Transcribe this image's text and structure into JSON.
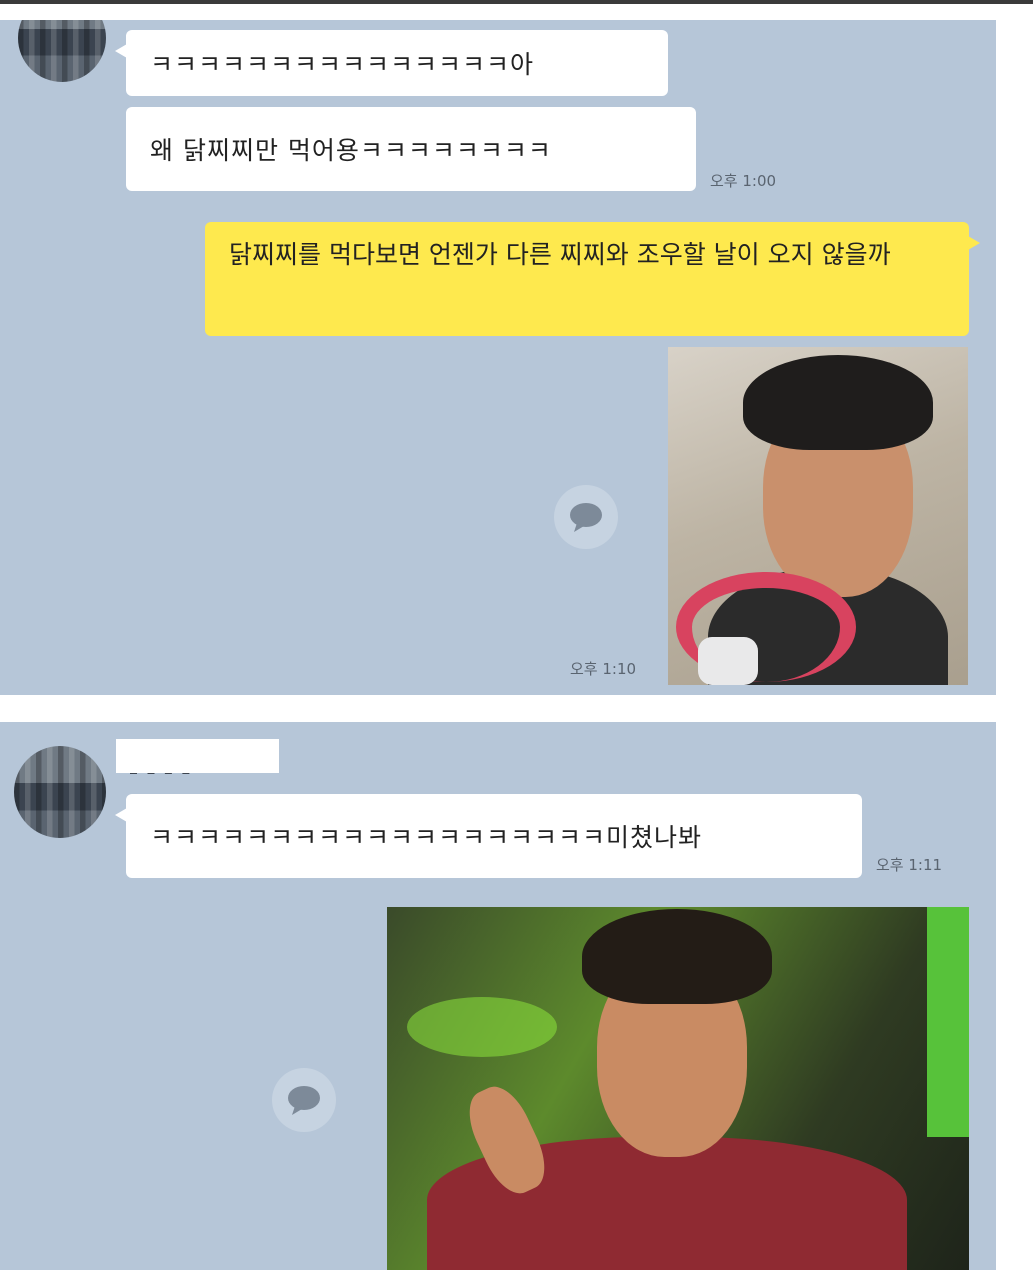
{
  "conversation": {
    "segment1": {
      "friend_messages": [
        "ㅋㅋㅋㅋㅋㅋㅋㅋㅋㅋㅋㅋㅋㅋㅋ아",
        "왜 닭찌찌만 먹어용ㅋㅋㅋㅋㅋㅋㅋㅋ"
      ],
      "friend_time": "오후 1:00",
      "my_message": "닭찌찌를 먹다보면 언젠가 다른 찌찌와 조우할 날이 오지 않을까",
      "my_time": "오후 1:10"
    },
    "segment2": {
      "friend_message": "ㅋㅋㅋㅋㅋㅋㅋㅋㅋㅋㅋㅋㅋㅋㅋㅋㅋㅋㅋ미쳤나봐",
      "friend_time": "오후 1:11"
    }
  },
  "icons": {
    "share": "speech-bubble-icon",
    "avatar": "pixelated-avatar"
  },
  "colors": {
    "chat_background": "#b6c6d8",
    "my_bubble": "#fee94e",
    "friend_bubble": "#ffffff"
  }
}
